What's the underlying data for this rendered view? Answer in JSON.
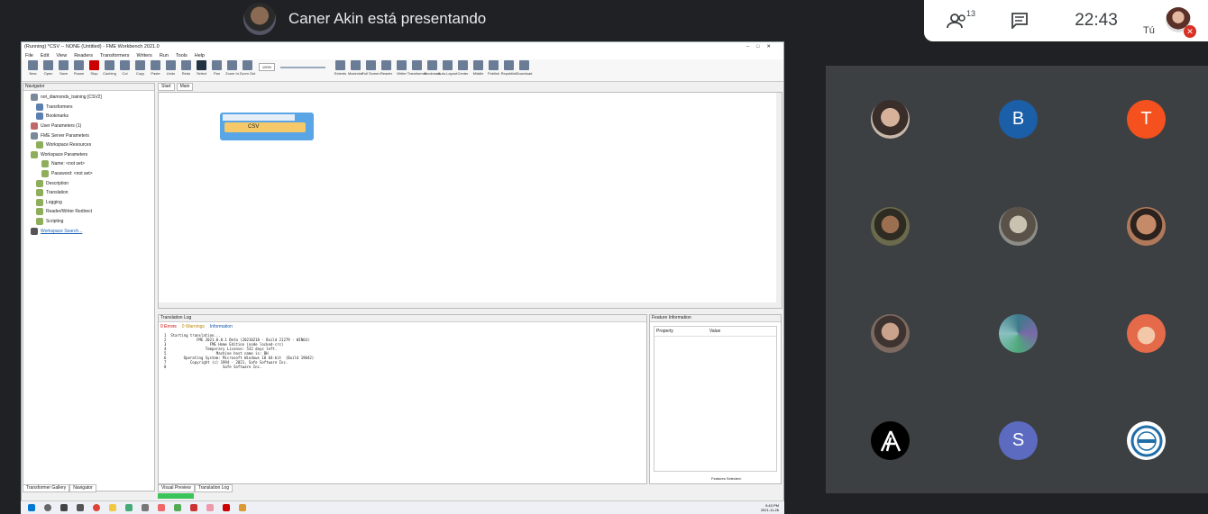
{
  "meet": {
    "presenter_text": "Caner Akin está presentando",
    "participants_count": "13",
    "time": "22:43",
    "self_label": "Tú",
    "tiles": [
      {
        "type": "photo",
        "color": "#b98c7a"
      },
      {
        "type": "letter",
        "letter": "B",
        "color": "#1a5fa8"
      },
      {
        "type": "letter",
        "letter": "T",
        "color": "#f4511e"
      },
      {
        "type": "photo",
        "color": "#6b6a4c"
      },
      {
        "type": "photo",
        "color": "#8d8d88"
      },
      {
        "type": "photo",
        "color": "#b07a5a"
      },
      {
        "type": "photo",
        "color": "#7d6a60"
      },
      {
        "type": "photo",
        "color": "#4e7a7a"
      },
      {
        "type": "photo",
        "color": "#e46a4a"
      },
      {
        "type": "logo",
        "color": "#000000"
      },
      {
        "type": "letter",
        "letter": "S",
        "color": "#5c6bc0"
      },
      {
        "type": "logo",
        "color": "#ffffff"
      }
    ]
  },
  "fme": {
    "title": "(Running) *CSV -- NONE (Untitled) - FME Workbench 2021.0",
    "menu": [
      "File",
      "Edit",
      "View",
      "Readers",
      "Transformers",
      "Writers",
      "Run",
      "Tools",
      "Help"
    ],
    "toolbar": [
      "New",
      "Open",
      "Save",
      "Pause",
      "Stop",
      "Caching",
      "Cut",
      "Copy",
      "Paste",
      "Undo",
      "Redo",
      "Select",
      "Pan",
      "Zoom In",
      "Zoom Out",
      "Extents",
      "Maximize",
      "Full Screen",
      "Reader",
      "Writer",
      "Transformer",
      "Bookmark",
      "Auto-Layout",
      "Center",
      "Middle",
      "Publish",
      "Republish",
      "Download"
    ],
    "zoom": "100%",
    "navigator": {
      "title": "Navigator",
      "items": [
        "not_diamonds_training [CSV2]",
        "Transformers",
        "Bookmarks",
        "User Parameters (1)",
        "FME Server Parameters",
        "Workspace Resources",
        "Workspace Parameters",
        "Name: <not set>",
        "Password: <not set>",
        "Description",
        "Translation",
        "Logging",
        "Reader/Writer Redirect",
        "Scripting",
        "Workspace Search..."
      ],
      "bottom_tabs": [
        "Transformer Gallery",
        "Navigator"
      ]
    },
    "canvas_tabs": [
      "Start",
      "Main"
    ],
    "node_label": "CSV",
    "log": {
      "title": "Translation Log",
      "errors": "0 Errors",
      "warnings": "0 Warnings",
      "info": "Information",
      "lines": [
        "1  Starting translation...",
        "2              FME 2021.0.0.1 Beta (20210218 - Build 21279 - WIN64)",
        "3                    FME Home Edition (node locked-crc)",
        "4                  Temporary License: 532 days left.",
        "5                       Machine host name is: BH",
        "6        Operating System: Microsoft Windows 10 64-bit  (Build 19042)",
        "7           Copyright (c) 1994 - 2021, Safe Software Inc.",
        "8                          Safe Software Inc."
      ],
      "bottom_tabs": [
        "Visual Preview",
        "Translation Log"
      ]
    },
    "feature_info": {
      "title": "Feature Information",
      "col1": "Property",
      "col2": "Value",
      "footer": "Features Selected:"
    },
    "taskbar_time": "9:43 PM",
    "taskbar_date": "2021-11-26"
  }
}
